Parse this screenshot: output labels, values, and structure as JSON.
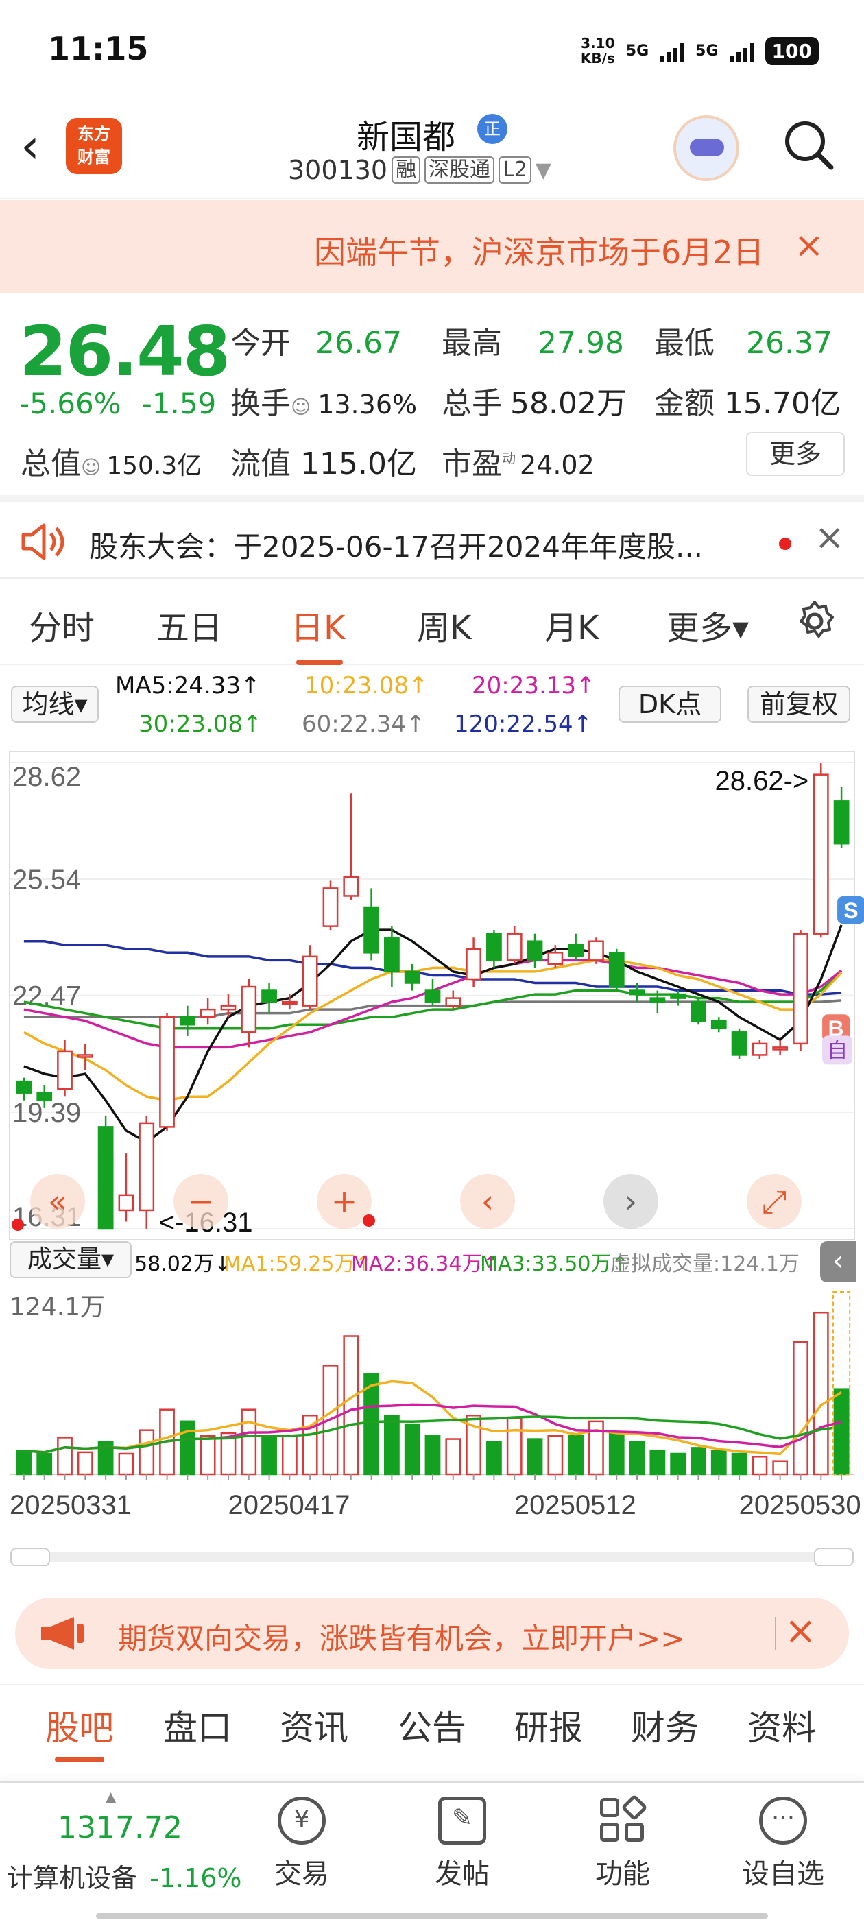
{
  "status": {
    "time": "11:15",
    "speed_value": "3.10",
    "speed_unit": "KB/s",
    "net1": "5G",
    "net2": "5G",
    "battery": "100"
  },
  "header": {
    "back_icon": "chevron-left-icon",
    "logo": "东方财富",
    "stock_name": "新国都",
    "badge": "正",
    "code": "300130",
    "tags": [
      "融",
      "深股通",
      "L2"
    ]
  },
  "notice": {
    "text": "因端午节，沪深京市场于6月2日",
    "close": "×"
  },
  "quote": {
    "price": "26.48",
    "change_pct": "-5.66%",
    "change_abs": "-1.59",
    "open_label": "今开",
    "open_value": "26.67",
    "high_label": "最高",
    "high_value": "27.98",
    "low_label": "最低",
    "low_value": "26.37",
    "turnover_label": "换手",
    "turnover_value": "13.36%",
    "volume_label": "总手",
    "volume_value": "58.02万",
    "amount_label": "金额",
    "amount_value": "15.70亿",
    "mktcap_label": "总值",
    "mktcap_value": "150.3亿",
    "float_label": "流值",
    "float_value": "115.0亿",
    "pe_label": "市盈",
    "pe_sup": "动",
    "pe_value": "24.02",
    "more_button": "更多"
  },
  "shareholder": {
    "text": "股东大会：于2025-06-17召开2024年年度股...",
    "close": "×"
  },
  "tabs": [
    "分时",
    "五日",
    "日K",
    "周K",
    "月K",
    "更多▾"
  ],
  "active_tab": "日K",
  "ma_legend": {
    "selector": "均线▾",
    "ma5": "MA5:24.33↑",
    "ma10": "10:23.08↑",
    "ma20": "20:23.13↑",
    "ma30": "30:23.08↑",
    "ma60": "60:22.34↑",
    "ma120": "120:22.54↑",
    "dk_button": "DK点",
    "adjust_button": "前复权"
  },
  "chart_data": {
    "type": "candlestick",
    "y_ticks": [
      "28.62",
      "25.54",
      "22.47",
      "19.39",
      "16.31"
    ],
    "ylim": [
      16.31,
      28.62
    ],
    "high_annotation": "28.62->",
    "low_annotation": "<-16.31",
    "b_marker": "B",
    "s_marker": "S",
    "zi_marker": "自",
    "x_labels": [
      "20250331",
      "20250417",
      "20250512",
      "20250530"
    ],
    "candles": [
      {
        "o": 20.2,
        "c": 19.9,
        "h": 20.3,
        "l": 19.7
      },
      {
        "o": 19.9,
        "c": 19.7,
        "h": 20.1,
        "l": 19.5
      },
      {
        "o": 20.0,
        "c": 21.0,
        "h": 21.3,
        "l": 19.8
      },
      {
        "o": 20.9,
        "c": 20.9,
        "h": 21.2,
        "l": 20.5
      },
      {
        "o": 19.0,
        "c": 16.31,
        "h": 19.3,
        "l": 16.31
      },
      {
        "o": 16.8,
        "c": 17.2,
        "h": 18.3,
        "l": 16.5
      },
      {
        "o": 16.8,
        "c": 19.1,
        "h": 19.3,
        "l": 16.3
      },
      {
        "o": 19.0,
        "c": 21.9,
        "h": 22.0,
        "l": 18.9
      },
      {
        "o": 21.9,
        "c": 21.7,
        "h": 22.2,
        "l": 21.4
      },
      {
        "o": 21.9,
        "c": 22.1,
        "h": 22.4,
        "l": 21.7
      },
      {
        "o": 22.1,
        "c": 22.2,
        "h": 22.5,
        "l": 21.9
      },
      {
        "o": 21.5,
        "c": 22.7,
        "h": 22.9,
        "l": 21.1
      },
      {
        "o": 22.6,
        "c": 22.3,
        "h": 22.8,
        "l": 22.0
      },
      {
        "o": 22.3,
        "c": 22.3,
        "h": 22.5,
        "l": 22.1
      },
      {
        "o": 22.2,
        "c": 23.5,
        "h": 23.8,
        "l": 22.1
      },
      {
        "o": 24.3,
        "c": 25.3,
        "h": 25.5,
        "l": 24.2
      },
      {
        "o": 25.1,
        "c": 25.6,
        "h": 27.8,
        "l": 25.0
      },
      {
        "o": 24.8,
        "c": 23.6,
        "h": 25.3,
        "l": 23.4
      },
      {
        "o": 24.0,
        "c": 23.1,
        "h": 24.3,
        "l": 22.7
      },
      {
        "o": 23.1,
        "c": 22.8,
        "h": 23.3,
        "l": 22.6
      },
      {
        "o": 22.6,
        "c": 22.3,
        "h": 22.9,
        "l": 22.2
      },
      {
        "o": 22.2,
        "c": 22.4,
        "h": 22.6,
        "l": 22.1
      },
      {
        "o": 22.9,
        "c": 23.7,
        "h": 24.0,
        "l": 22.7
      },
      {
        "o": 24.1,
        "c": 23.4,
        "h": 24.2,
        "l": 23.2
      },
      {
        "o": 23.4,
        "c": 24.1,
        "h": 24.3,
        "l": 23.3
      },
      {
        "o": 23.9,
        "c": 23.4,
        "h": 24.1,
        "l": 23.2
      },
      {
        "o": 23.3,
        "c": 23.6,
        "h": 23.8,
        "l": 23.2
      },
      {
        "o": 23.8,
        "c": 23.5,
        "h": 24.1,
        "l": 23.4
      },
      {
        "o": 23.4,
        "c": 23.9,
        "h": 24.0,
        "l": 23.3
      },
      {
        "o": 23.6,
        "c": 22.7,
        "h": 23.7,
        "l": 22.6
      },
      {
        "o": 22.6,
        "c": 22.5,
        "h": 22.8,
        "l": 22.3
      },
      {
        "o": 22.4,
        "c": 22.3,
        "h": 22.6,
        "l": 22.0
      },
      {
        "o": 22.5,
        "c": 22.4,
        "h": 22.6,
        "l": 22.2
      },
      {
        "o": 22.3,
        "c": 21.8,
        "h": 22.4,
        "l": 21.7
      },
      {
        "o": 21.8,
        "c": 21.6,
        "h": 21.9,
        "l": 21.5
      },
      {
        "o": 21.5,
        "c": 20.9,
        "h": 21.6,
        "l": 20.8
      },
      {
        "o": 20.9,
        "c": 21.2,
        "h": 21.3,
        "l": 20.8
      },
      {
        "o": 21.1,
        "c": 21.1,
        "h": 21.3,
        "l": 20.9
      },
      {
        "o": 21.2,
        "c": 24.1,
        "h": 24.2,
        "l": 21.0
      },
      {
        "o": 24.1,
        "c": 28.3,
        "h": 28.62,
        "l": 24.0
      },
      {
        "o": 27.6,
        "c": 26.48,
        "h": 27.98,
        "l": 26.37
      }
    ],
    "ma5": [
      20.6,
      20.4,
      20.3,
      20.4,
      19.7,
      18.9,
      18.6,
      19.0,
      19.8,
      21.0,
      21.9,
      22.2,
      22.3,
      22.4,
      22.8,
      23.3,
      23.9,
      24.2,
      24.2,
      23.9,
      23.5,
      23.1,
      23.0,
      23.2,
      23.3,
      23.5,
      23.7,
      23.7,
      23.6,
      23.4,
      23.1,
      22.9,
      22.7,
      22.5,
      22.3,
      21.9,
      21.6,
      21.3,
      21.8,
      22.9,
      24.33
    ],
    "ma10": [
      21.5,
      21.2,
      21.0,
      20.8,
      20.5,
      20.1,
      19.8,
      19.7,
      19.8,
      19.8,
      20.2,
      20.7,
      21.2,
      21.6,
      22.0,
      22.3,
      22.6,
      22.9,
      23.1,
      23.1,
      23.2,
      23.2,
      23.1,
      23.1,
      23.1,
      23.1,
      23.2,
      23.3,
      23.4,
      23.4,
      23.3,
      23.2,
      23.0,
      22.9,
      22.7,
      22.5,
      22.3,
      22.1,
      22.1,
      22.5,
      23.08
    ],
    "ma20": [
      22.1,
      22.0,
      21.9,
      21.8,
      21.6,
      21.4,
      21.2,
      21.1,
      21.1,
      21.1,
      21.1,
      21.2,
      21.3,
      21.4,
      21.5,
      21.7,
      21.9,
      22.1,
      22.3,
      22.4,
      22.6,
      22.8,
      23.0,
      23.2,
      23.3,
      23.4,
      23.4,
      23.4,
      23.4,
      23.3,
      23.2,
      23.2,
      23.1,
      23.0,
      22.9,
      22.8,
      22.6,
      22.5,
      22.5,
      22.7,
      23.13
    ],
    "ma30": [
      22.3,
      22.2,
      22.1,
      22.0,
      21.9,
      21.8,
      21.7,
      21.6,
      21.6,
      21.6,
      21.6,
      21.6,
      21.6,
      21.7,
      21.7,
      21.7,
      21.8,
      21.9,
      21.9,
      22.0,
      22.1,
      22.1,
      22.2,
      22.3,
      22.4,
      22.5,
      22.5,
      22.6,
      22.6,
      22.6,
      22.5,
      22.5,
      22.5,
      22.4,
      22.4,
      22.3,
      22.3,
      22.3,
      22.3,
      22.6,
      23.08
    ],
    "ma60": [
      21.9,
      21.9,
      21.9,
      21.9,
      21.9,
      21.9,
      21.9,
      21.9,
      21.9,
      21.9,
      22.0,
      22.0,
      22.0,
      22.0,
      22.1,
      22.1,
      22.1,
      22.2,
      22.2,
      22.2,
      22.2,
      22.2,
      22.2,
      22.3,
      22.3,
      22.3,
      22.3,
      22.3,
      22.3,
      22.3,
      22.3,
      22.3,
      22.3,
      22.3,
      22.3,
      22.3,
      22.3,
      22.3,
      22.3,
      22.3,
      22.34
    ],
    "ma120": [
      23.9,
      23.9,
      23.8,
      23.8,
      23.8,
      23.7,
      23.7,
      23.6,
      23.6,
      23.5,
      23.5,
      23.5,
      23.4,
      23.4,
      23.3,
      23.3,
      23.2,
      23.2,
      23.1,
      23.1,
      23.0,
      23.0,
      22.9,
      22.9,
      22.9,
      22.8,
      22.8,
      22.8,
      22.7,
      22.7,
      22.7,
      22.7,
      22.6,
      22.6,
      22.6,
      22.6,
      22.6,
      22.6,
      22.5,
      22.5,
      22.54
    ],
    "volume": {
      "selector": "成交量▾",
      "current": "58.02万↓",
      "ma1": "MA1:59.25万↑",
      "ma2": "MA2:36.34万↑",
      "ma3": "MA3:33.50万↑",
      "virtual": "虚拟成交量:124.1万",
      "ymax_label": "124.1万",
      "ymax": 124.1,
      "values": [
        16,
        14,
        25,
        15,
        22,
        14,
        30,
        44,
        36,
        26,
        28,
        44,
        26,
        26,
        40,
        74,
        94,
        68,
        40,
        34,
        26,
        24,
        40,
        22,
        38,
        24,
        26,
        26,
        36,
        28,
        22,
        16,
        14,
        18,
        16,
        14,
        12,
        9,
        90,
        110,
        58
      ]
    }
  },
  "chart_controls": [
    "«",
    "−",
    "+",
    "‹",
    "›",
    "⤢"
  ],
  "ad": {
    "text": "期货双向交易，涨跌皆有机会，立即开户>>",
    "close": "×"
  },
  "bottom_tabs": [
    "股吧",
    "盘口",
    "资讯",
    "公告",
    "研报",
    "财务",
    "资料"
  ],
  "footer": {
    "index_value": "1317.72",
    "index_name": "计算机设备",
    "index_change": "-1.16%",
    "items": [
      "交易",
      "发帖",
      "功能",
      "设自选"
    ]
  },
  "colors": {
    "up": "#d93a3a",
    "down": "#14a020",
    "accent": "#e4572e",
    "ma5": "#111111",
    "ma10": "#f0b020",
    "ma20": "#d020a0",
    "ma30": "#20a020",
    "ma60": "#777777",
    "ma120": "#2030a0"
  }
}
